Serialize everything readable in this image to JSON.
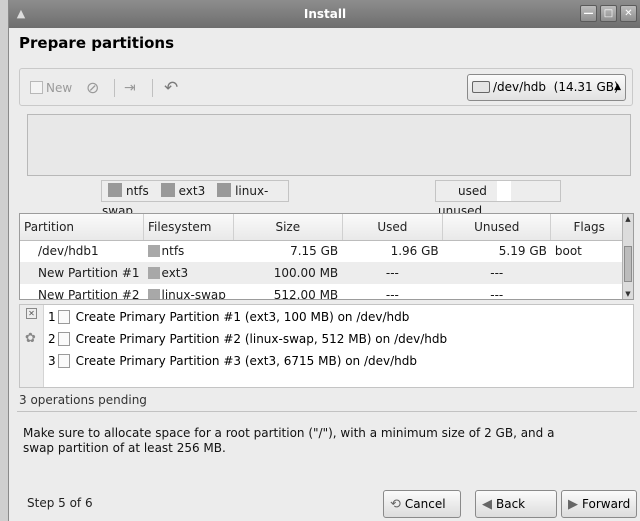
{
  "window": {
    "title": "Install",
    "controls": [
      "minimize",
      "maximize",
      "close"
    ]
  },
  "page": {
    "heading": "Prepare partitions"
  },
  "toolbar": {
    "new_label": "New",
    "disk_selector_value": "/dev/hdb  (14.31 GB)"
  },
  "legend": {
    "fs_types": [
      {
        "label": "ntfs",
        "color": "#9a9a9a"
      },
      {
        "label": "ext3",
        "color": "#8f8f8f"
      },
      {
        "label": "linux-swap",
        "color": "#8a8a8a"
      }
    ],
    "usage": [
      {
        "label": "used",
        "color": "#ececec"
      },
      {
        "label": "unused",
        "color": "#ffffff"
      }
    ]
  },
  "partitions": {
    "columns": [
      "Partition",
      "Filesystem",
      "Size",
      "Used",
      "Unused",
      "Flags"
    ],
    "rows": [
      {
        "partition": "/dev/hdb1",
        "filesystem": "ntfs",
        "size": "7.15 GB",
        "used": "1.96 GB",
        "unused": "5.19 GB",
        "flags": "boot"
      },
      {
        "partition": "New Partition #1",
        "filesystem": "ext3",
        "size": "100.00 MB",
        "used": "---",
        "unused": "---",
        "flags": ""
      },
      {
        "partition": "New Partition #2",
        "filesystem": "linux-swap",
        "size": "512.00 MB",
        "used": "---",
        "unused": "---",
        "flags": ""
      }
    ]
  },
  "operations": {
    "items": [
      {
        "num": "1",
        "text": "Create Primary Partition #1 (ext3, 100 MB) on /dev/hdb"
      },
      {
        "num": "2",
        "text": "Create Primary Partition #2 (linux-swap, 512 MB) on /dev/hdb"
      },
      {
        "num": "3",
        "text": "Create Primary Partition #3 (ext3, 6715 MB) on /dev/hdb"
      }
    ],
    "pending_text": "3 operations pending"
  },
  "message": "Make sure to allocate space for a root partition (\"/\"), with a minimum size of 2 GB, and a swap partition of at least 256 MB.",
  "footer": {
    "step": "Step 5 of 6",
    "cancel": "Cancel",
    "back": "Back",
    "forward": "Forward"
  }
}
